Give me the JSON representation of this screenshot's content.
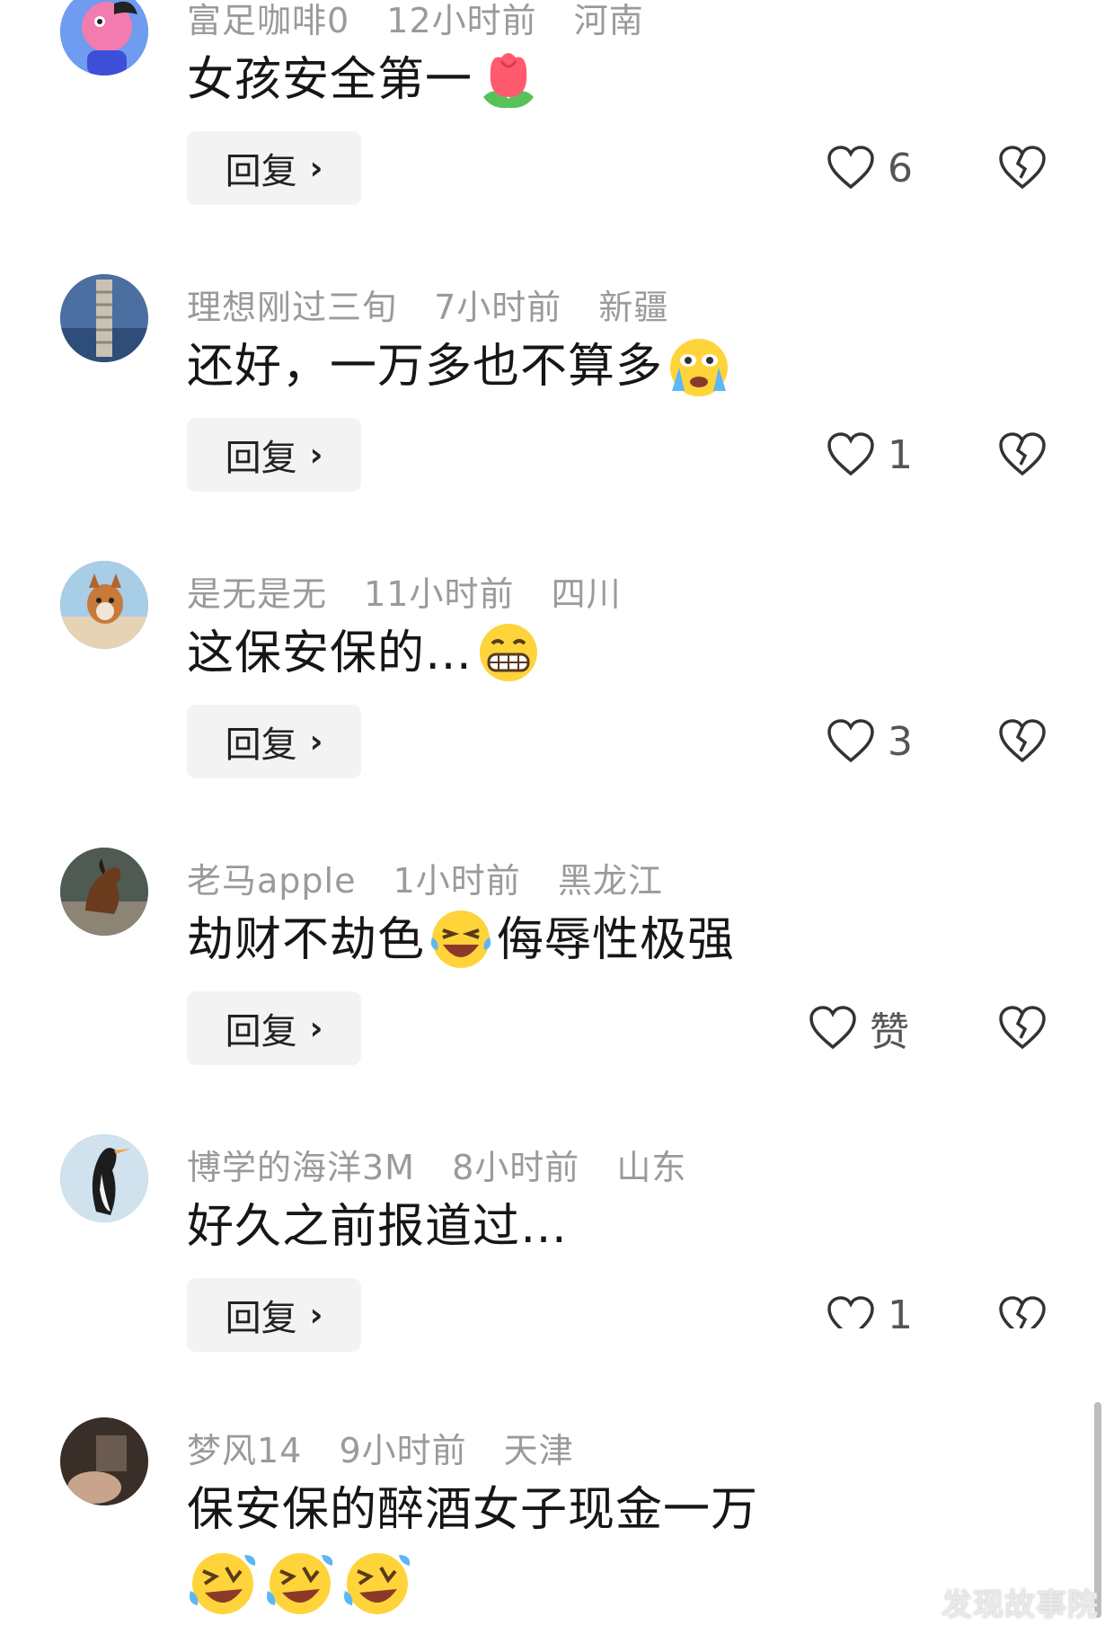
{
  "comments": [
    {
      "username": "富足咖啡0",
      "time": "12小时前",
      "location": "河南",
      "text": "女孩安全第一",
      "emoji": "tulip-emoji",
      "reply_label": "回复",
      "like_count": "6"
    },
    {
      "username": "理想刚过三旬",
      "time": "7小时前",
      "location": "新疆",
      "text": "还好，一万多也不算多",
      "emoji": "crying-face-emoji",
      "reply_label": "回复",
      "like_count": "1"
    },
    {
      "username": "是无是无",
      "time": "11小时前",
      "location": "四川",
      "text": "这保安保的…",
      "emoji": "grinning-teeth-emoji",
      "reply_label": "回复",
      "like_count": "3"
    },
    {
      "username": "老马apple",
      "time": "1小时前",
      "location": "黑龙江",
      "text_before": "劫财不劫色",
      "text_after": "侮辱性极强",
      "emoji": "laughing-tears-emoji",
      "reply_label": "回复",
      "like_count": "赞"
    },
    {
      "username": "博学的海洋3M",
      "time": "8小时前",
      "location": "山东",
      "text": "好久之前报道过…",
      "reply_label": "回复",
      "like_count": "1"
    },
    {
      "username": "梦风14",
      "time": "9小时前",
      "location": "天津",
      "text": "保安保的醉酒女子现金一万",
      "emojis": [
        "rolling-laugh-emoji",
        "rolling-laugh-emoji",
        "rolling-laugh-emoji"
      ]
    }
  ],
  "watermark": "发现故事院",
  "icons": {
    "like": "heart-outline-icon",
    "dislike": "broken-heart-icon",
    "reply_chevron": "chevron-right-icon"
  }
}
